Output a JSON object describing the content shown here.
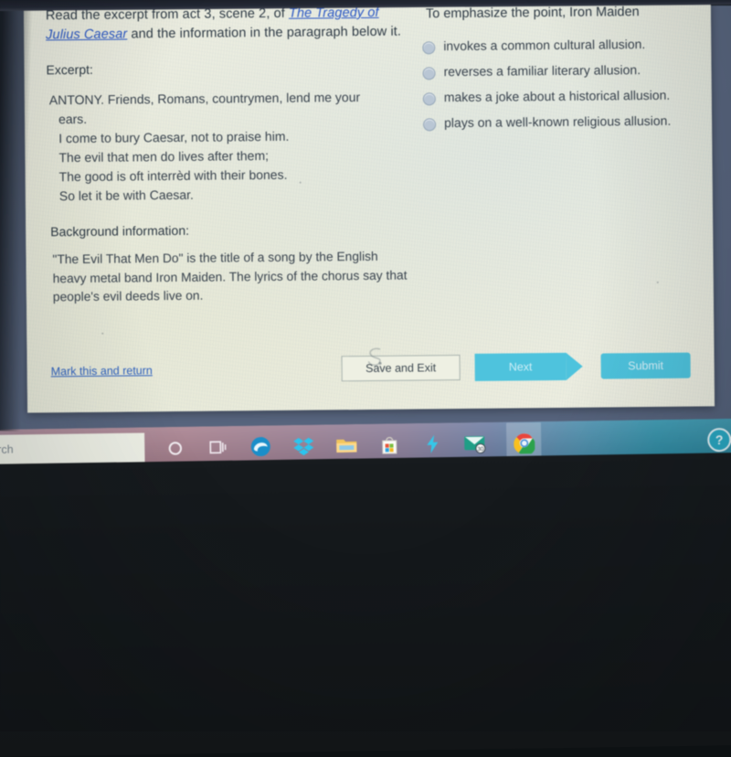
{
  "quiz": {
    "prompt_before_link": "Read the excerpt from act 3, scene 2, of ",
    "prompt_link": "The Tragedy of Julius Caesar",
    "prompt_after_link": " and the information in the paragraph below it.",
    "excerpt_label": "Excerpt:",
    "excerpt_lines": [
      "ANTONY. Friends, Romans, countrymen, lend me your",
      "ears.",
      "I come to bury Caesar, not to praise him.",
      "The evil that men do lives after them;",
      "The good is oft interrèd with their bones.",
      "So let it be with Caesar."
    ],
    "background_label": "Background information:",
    "background_text": "\"The Evil That Men Do\" is the title of a song by the English heavy metal band Iron Maiden. The lyrics of the chorus say that people's evil deeds live on.",
    "question": "To emphasize the point, Iron Maiden",
    "choices": [
      {
        "label": "invokes a common cultural allusion.",
        "selected": false
      },
      {
        "label": "reverses a familiar literary allusion.",
        "selected": false
      },
      {
        "label": "makes a joke about a historical allusion.",
        "selected": false
      },
      {
        "label": "plays on a well-known religious allusion.",
        "selected": false
      }
    ]
  },
  "footer": {
    "mark_link": "Mark this and return",
    "save_label": "Save and Exit",
    "next_label": "Next",
    "submit_label": "Submit"
  },
  "taskbar": {
    "search_placeholder": "arch",
    "icons": [
      {
        "name": "cortana-icon",
        "glyph": "◯"
      },
      {
        "name": "task-view-icon",
        "glyph": "⌸"
      },
      {
        "name": "edge-icon",
        "glyph": "e"
      },
      {
        "name": "dropbox-icon",
        "glyph": "❖"
      },
      {
        "name": "file-explorer-icon",
        "glyph": "🗁"
      },
      {
        "name": "microsoft-store-icon",
        "glyph": "⊞"
      },
      {
        "name": "bolt-icon",
        "glyph": "⚡"
      },
      {
        "name": "mail-icon",
        "glyph": "✉"
      },
      {
        "name": "chrome-icon",
        "glyph": "◉"
      }
    ],
    "mail_badge": "30",
    "help_glyph": "?"
  },
  "colors": {
    "panel_bg": "#edeee0",
    "accent_cyan": "#4ec3dd",
    "link_blue": "#2a57c4",
    "text": "#39434e",
    "desktop": "#5d6a82"
  }
}
